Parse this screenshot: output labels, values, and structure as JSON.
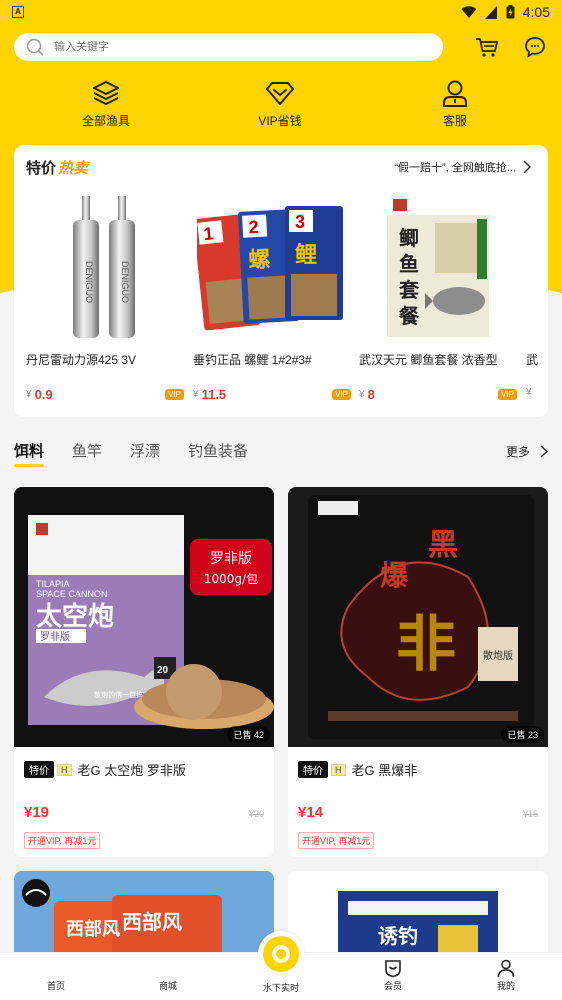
{
  "status_bar": {
    "time": "4:05",
    "badge": "A"
  },
  "search": {
    "placeholder": "输入关键字"
  },
  "quick_nav": [
    {
      "label": "全部渔具",
      "icon": "layers-icon"
    },
    {
      "label": "VIP省钱",
      "icon": "diamond-icon"
    },
    {
      "label": "客服",
      "icon": "user-icon"
    }
  ],
  "deals": {
    "title": "特价",
    "title_hot": "热卖",
    "slogan": "“假一赔十”, 全网触底抢...",
    "currency": "¥",
    "vip_badge": "VIP",
    "items": [
      {
        "name": "丹尼雷动力源425 3V",
        "price": "0.9"
      },
      {
        "name": "垂钓正品 螺鲤 1#2#3#",
        "price": "11.5"
      },
      {
        "name": "武汉天元 鲫鱼套餐 浓香型",
        "price": "8"
      },
      {
        "name": "武",
        "price": ""
      }
    ]
  },
  "categories": {
    "tabs": [
      "饵料",
      "鱼竿",
      "浮漂",
      "钓鱼装备"
    ],
    "active_index": 0,
    "more": "更多"
  },
  "products": [
    {
      "title": "老G 太空炮 罗非版",
      "tag_sale": "特价",
      "tag_h": "H",
      "price": "¥19",
      "old_price": "¥20",
      "sold": "已售 42",
      "vip_note": "开通VIP, 再减1元",
      "image_text": {
        "en1": "TILAPIA",
        "en2": "SPACE CANNON",
        "cn": "太空炮",
        "sub": "罗非版",
        "badge1": "罗非版",
        "badge2": "1000g/包",
        "weight": "20",
        "slogan": "散炮钓谓一包搞定"
      }
    },
    {
      "title": "老G 黑爆非",
      "tag_sale": "特价",
      "tag_h": "H",
      "price": "¥14",
      "old_price": "¥15",
      "sold": "已售 23",
      "vip_note": "开通VIP, 再减1元",
      "image_text": {
        "c1": "黑",
        "c2": "爆",
        "c3": "非",
        "label": "散炮版"
      }
    }
  ],
  "products_partial": [
    {
      "image_text": "西部风"
    },
    {
      "image_text": "诱钓"
    }
  ],
  "bottom_nav": [
    {
      "label": "首页",
      "icon": "home-icon"
    },
    {
      "label": "商城",
      "icon": "shop-icon"
    },
    {
      "label": "水下实时",
      "icon": "live-icon"
    },
    {
      "label": "会员",
      "icon": "member-icon"
    },
    {
      "label": "我的",
      "icon": "profile-icon"
    }
  ],
  "colors": {
    "brand_yellow": "#ffd400",
    "price_red": "#e53935",
    "vip_orange": "#f39c12"
  }
}
